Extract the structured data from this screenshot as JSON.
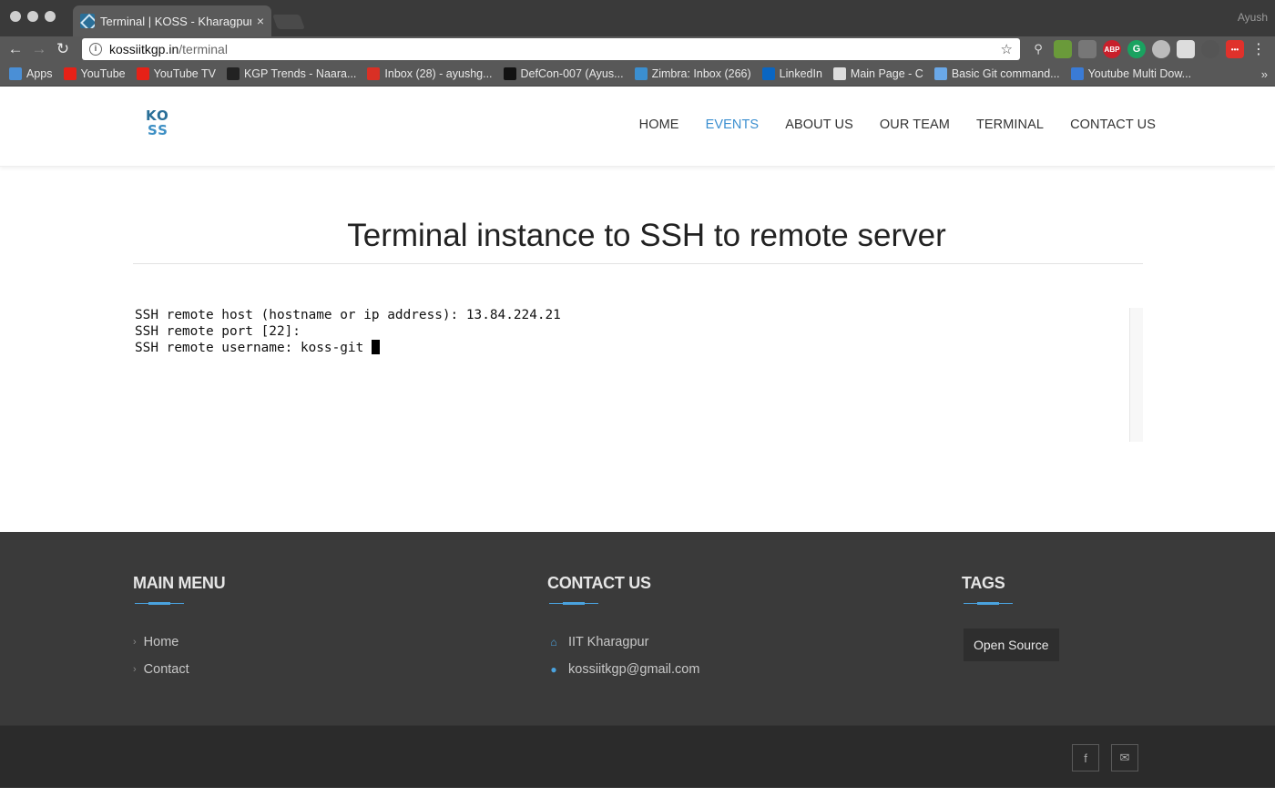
{
  "browser": {
    "tab_title": "Terminal | KOSS - Kharagpur O",
    "tab_close": "×",
    "profile_name": "Ayush",
    "url_host": "kossiitkgp.in",
    "url_path": "/terminal",
    "bookmarks": [
      {
        "label": "Apps",
        "icon": "apps-grid-icon",
        "color": "#4a8fd6"
      },
      {
        "label": "YouTube",
        "icon": "youtube-icon",
        "color": "#e62117"
      },
      {
        "label": "YouTube TV",
        "icon": "youtube-icon",
        "color": "#e62117"
      },
      {
        "label": "KGP Trends - Naara...",
        "icon": "m-icon",
        "color": "#222222"
      },
      {
        "label": "Inbox (28) - ayushg...",
        "icon": "gmail-icon",
        "color": "#d93025"
      },
      {
        "label": "DefCon-007 (Ayus...",
        "icon": "github-icon",
        "color": "#111111"
      },
      {
        "label": "Zimbra: Inbox (266)",
        "icon": "zimbra-icon",
        "color": "#3b8fd0"
      },
      {
        "label": "LinkedIn",
        "icon": "linkedin-icon",
        "color": "#0a66c2"
      },
      {
        "label": "Main Page - C",
        "icon": "page-icon",
        "color": "#dddddd"
      },
      {
        "label": "Basic Git command...",
        "icon": "git-icon",
        "color": "#6aa8e8"
      },
      {
        "label": "Youtube Multi Dow...",
        "icon": "download-icon",
        "color": "#3a7bd5"
      }
    ],
    "bookmarks_more": "»"
  },
  "site": {
    "logo_top": "KO",
    "logo_bottom": "SS",
    "nav": [
      {
        "label": "HOME",
        "active": false
      },
      {
        "label": "EVENTS",
        "active": true
      },
      {
        "label": "ABOUT US",
        "active": false
      },
      {
        "label": "OUR TEAM",
        "active": false
      },
      {
        "label": "TERMINAL",
        "active": false
      },
      {
        "label": "CONTACT US",
        "active": false
      }
    ],
    "accent_color": "#3b8fd0"
  },
  "main": {
    "title": "Terminal instance to SSH to remote server",
    "terminal_lines": [
      "SSH remote host (hostname or ip address): 13.84.224.21",
      "SSH remote port [22]:",
      "SSH remote username: koss-git "
    ]
  },
  "footer": {
    "main_menu": {
      "heading": "MAIN MENU",
      "items": [
        "Home",
        "Contact"
      ]
    },
    "contact": {
      "heading": "CONTACT US",
      "address": "IIT Kharagpur",
      "email": "kossiitkgp@gmail.com"
    },
    "tags": {
      "heading": "TAGS",
      "items": [
        "Open Source"
      ]
    },
    "social": [
      {
        "icon": "facebook-icon",
        "glyph": "f"
      },
      {
        "icon": "email-icon",
        "glyph": "✉"
      }
    ]
  }
}
